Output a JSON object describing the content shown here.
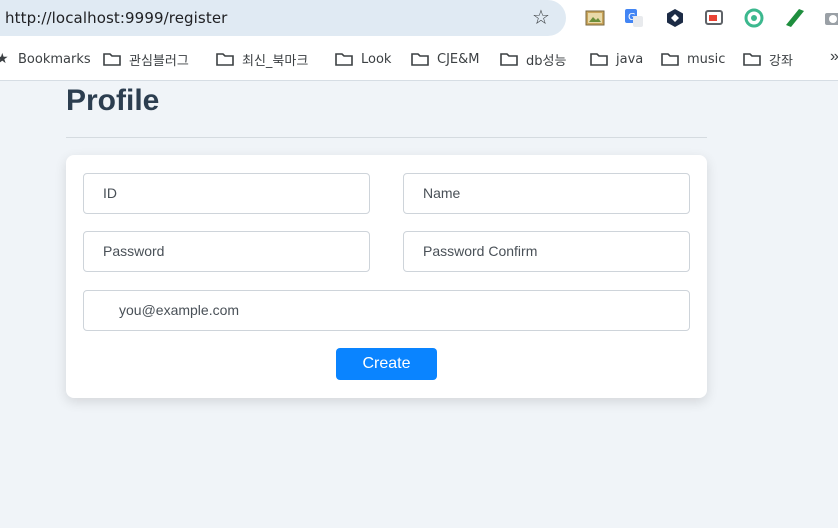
{
  "browser": {
    "url": "http://localhost:9999/register",
    "bookmarks": [
      "Bookmarks",
      "관심블러그",
      "최신_북마크",
      "Look",
      "CJE&M",
      "db성능",
      "java",
      "music",
      "강좌"
    ],
    "more": "»"
  },
  "page": {
    "title": "Profile",
    "fields": {
      "id_placeholder": "ID",
      "name_placeholder": "Name",
      "password_placeholder": "Password",
      "password_confirm_placeholder": "Password Confirm",
      "email_placeholder": "you@example.com"
    },
    "create_label": "Create"
  },
  "colors": {
    "accent": "#0a84ff",
    "background": "#f0f4f8"
  }
}
